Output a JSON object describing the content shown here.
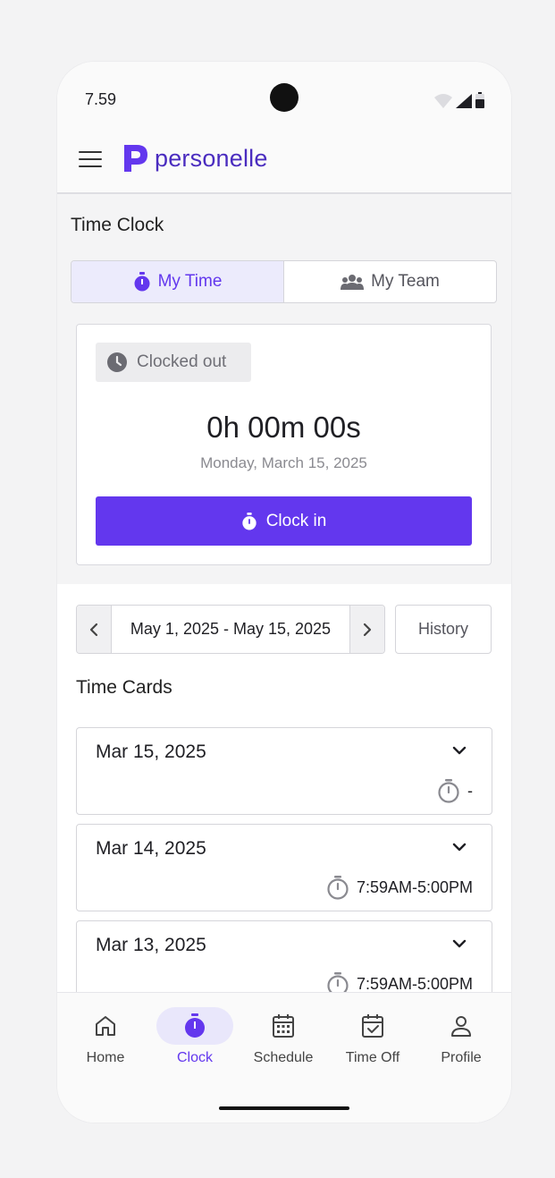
{
  "status_bar": {
    "time": "7.59"
  },
  "app": {
    "name": "personelle"
  },
  "page": {
    "title": "Time Clock"
  },
  "tabs": [
    {
      "label": "My Time",
      "active": true
    },
    {
      "label": "My Team",
      "active": false
    }
  ],
  "clock": {
    "status": "Clocked out",
    "elapsed": "0h 00m 00s",
    "date": "Monday, March 15, 2025",
    "button": "Clock in"
  },
  "period": {
    "range": "May 1, 2025 - May 15, 2025",
    "history_label": "History"
  },
  "time_cards": {
    "title": "Time Cards",
    "items": [
      {
        "date": "Mar 15, 2025",
        "hours": "-"
      },
      {
        "date": "Mar 14, 2025",
        "hours": "7:59AM-5:00PM"
      },
      {
        "date": "Mar 13, 2025",
        "hours": "7:59AM-5:00PM"
      }
    ]
  },
  "nav": [
    {
      "label": "Home",
      "icon": "home-icon"
    },
    {
      "label": "Clock",
      "icon": "stopwatch-icon",
      "active": true
    },
    {
      "label": "Schedule",
      "icon": "calendar-icon"
    },
    {
      "label": "Time Off",
      "icon": "calendar-check-icon"
    },
    {
      "label": "Profile",
      "icon": "person-icon"
    }
  ],
  "colors": {
    "primary": "#6337EE",
    "brand": "#4A2CBF",
    "active_bg": "#ECEBFC"
  }
}
